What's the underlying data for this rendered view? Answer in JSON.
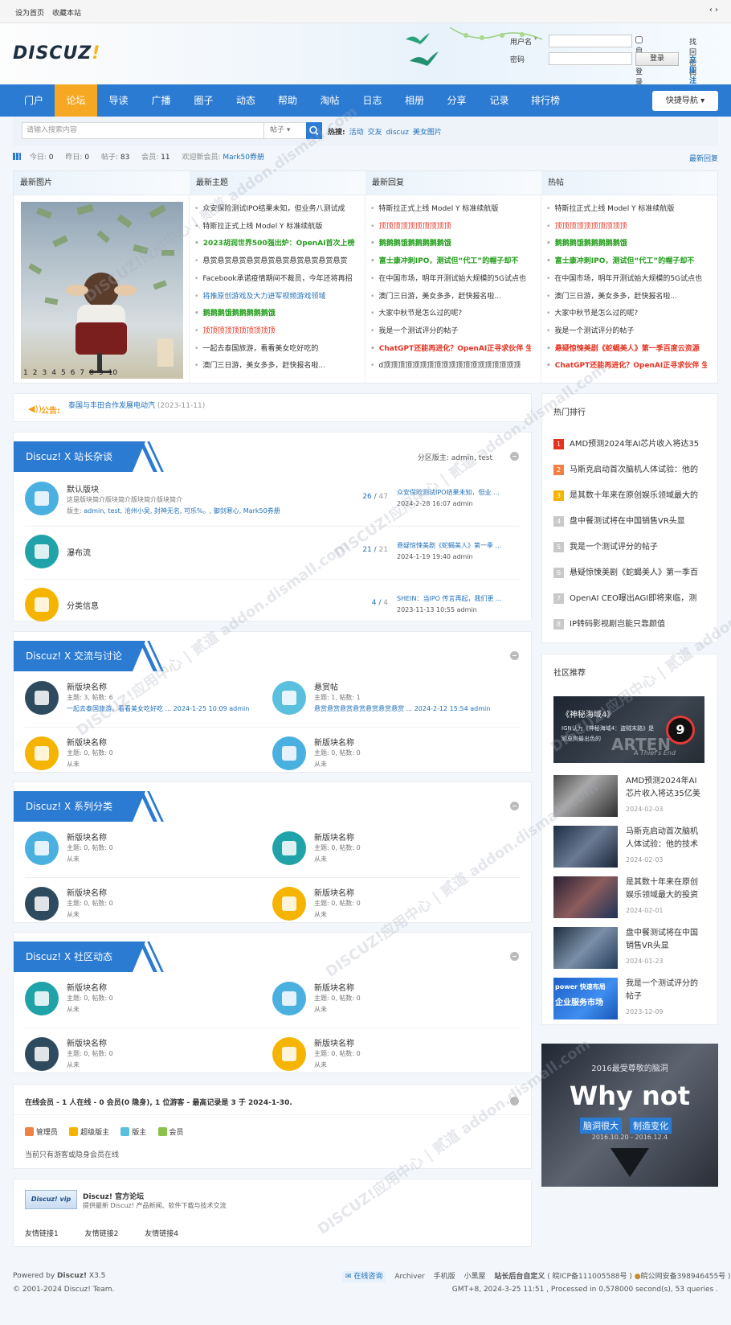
{
  "topbar": {
    "home": "设为首页",
    "fav": "收藏本站",
    "switch": "‹ ›"
  },
  "logo": {
    "main": "DISCUZ",
    "bang": "!"
  },
  "login": {
    "user_label": "用户名",
    "pass_label": "密码",
    "auto": "自动登录",
    "forgot": "找回密码",
    "submit": "登录",
    "register": "立即注册"
  },
  "nav": {
    "items": [
      "门户",
      "论坛",
      "导读",
      "广播",
      "圈子",
      "动态",
      "帮助",
      "淘帖",
      "日志",
      "相册",
      "分享",
      "记录",
      "排行榜"
    ],
    "active": 1,
    "quick": "快捷导航"
  },
  "search": {
    "placeholder": "请输入搜索内容",
    "type": "帖子",
    "hot_label": "热搜:",
    "hot": [
      "活动",
      "交友",
      "discuz",
      "美女图片"
    ]
  },
  "stats": {
    "today_label": "今日:",
    "today": "0",
    "yesterday_label": "昨日:",
    "yesterday": "0",
    "posts_label": "帖子:",
    "posts": "83",
    "members_label": "会员:",
    "members": "11",
    "welcome": "欢迎新会员:",
    "newuser": "Mark50券册",
    "latest_reply": "最新回复"
  },
  "portal": {
    "heads": [
      "最新图片",
      "最新主题",
      "最新回复",
      "热帖"
    ],
    "pager": [
      "1",
      "2",
      "3",
      "4",
      "5",
      "6",
      "7",
      "8",
      "9",
      "10"
    ],
    "topics": [
      {
        "t": "众安保险测试IPO结果未知，但业务八测试成",
        "c": ""
      },
      {
        "t": "特斯拉正式上线 Model Y 标准续航版",
        "c": ""
      },
      {
        "t": "2023胡润世界500强出炉：OpenAI首次上榜",
        "c": "grn"
      },
      {
        "t": "悬赏悬赏悬赏悬赏悬赏悬赏悬赏悬赏悬赏悬赏",
        "c": ""
      },
      {
        "t": "Facebook承诺疫情期间不裁员，今年还将再招",
        "c": ""
      },
      {
        "t": "将推原创游戏及大力进军视频游戏领域",
        "c": "blu"
      },
      {
        "t": "鹅鹅鹅饿鹅鹅鹅鹅鹅饿",
        "c": "grn"
      },
      {
        "t": "顶顶顶顶顶顶顶顶顶顶",
        "c": "red"
      },
      {
        "t": "一起去泰国旅游，看看美女吃好吃的",
        "c": ""
      },
      {
        "t": "澳门三日游，美女多多，赶快报名啦...",
        "c": ""
      }
    ],
    "replies": [
      {
        "t": "特斯拉正式上线 Model Y 标准续航版",
        "c": ""
      },
      {
        "t": "顶顶顶顶顶顶顶顶顶顶",
        "c": "red"
      },
      {
        "t": "鹅鹅鹅饿鹅鹅鹅鹅鹅饿",
        "c": "grn"
      },
      {
        "t": "富士康冲刺IPO，测试但“代工”的帽子却不",
        "c": "grn"
      },
      {
        "t": "在中国市场，明年开测试始大规模的5G试点也",
        "c": ""
      },
      {
        "t": "澳门三日游，美女多多，赶快报名啦...",
        "c": ""
      },
      {
        "t": "大家中秋节是怎么过的呢?",
        "c": ""
      },
      {
        "t": "我是一个测试评分的帖子",
        "c": ""
      },
      {
        "t": "ChatGPT还能再进化？OpenAI正寻求伙伴 生",
        "c": "bred"
      },
      {
        "t": "d顶顶顶顶顶顶顶顶顶顶顶顶顶顶顶顶顶顶顶",
        "c": ""
      }
    ],
    "hot": [
      {
        "t": "特斯拉正式上线 Model Y 标准续航版",
        "c": ""
      },
      {
        "t": "顶顶顶顶顶顶顶顶顶顶",
        "c": "red"
      },
      {
        "t": "鹅鹅鹅饿鹅鹅鹅鹅鹅饿",
        "c": "grn"
      },
      {
        "t": "富士康冲刺IPO，测试但“代工”的帽子却不",
        "c": "grn"
      },
      {
        "t": "在中国市场，明年开测试始大规模的5G试点也",
        "c": ""
      },
      {
        "t": "澳门三日游，美女多多，赶快报名啦...",
        "c": ""
      },
      {
        "t": "大家中秋节是怎么过的呢?",
        "c": ""
      },
      {
        "t": "我是一个测试评分的帖子",
        "c": ""
      },
      {
        "t": "悬疑惊悚美剧《蛇蝎美人》第一季百度云资源",
        "c": "bred"
      },
      {
        "t": "ChatGPT还能再进化？OpenAI正寻求伙伴 生",
        "c": "bred"
      }
    ]
  },
  "notice": {
    "label": "公告:",
    "text": "泰国与丰田合作发展电动汽",
    "date": "(2023-11-11)"
  },
  "sections": [
    {
      "title": "Discuz! X 站长杂谈",
      "mods": "分区版主: admin, test"
    },
    {
      "title": "Discuz! X 交流与讨论",
      "mods": ""
    },
    {
      "title": "Discuz! X 系列分类",
      "mods": ""
    },
    {
      "title": "Discuz! X 社区动态",
      "mods": ""
    }
  ],
  "sec1": [
    {
      "name": "默认版块",
      "desc": "这是版块简介版块简介版块简介版块简介",
      "mods_label": "版主:",
      "mods": "admin, test, 沧州小吴, 封神无名, 可乐%。, 御剑寒心, Mark50券册",
      "cnt": "26",
      "total": "47",
      "last": "众安保险测试IPO结果未知，但业 ...",
      "time": "2024-2-28 16:07 admin",
      "icon": "globe-icon",
      "bg": "#4ab0e0"
    },
    {
      "name": "瀑布流",
      "desc": "",
      "mods_label": "",
      "mods": "",
      "cnt": "21",
      "total": "21",
      "last": "悬疑惊悚美剧《蛇蝎美人》第一季 ...",
      "time": "2024-1-19 19:40 admin",
      "icon": "rocket-icon",
      "bg": "#1fa3a8"
    },
    {
      "name": "分类信息",
      "desc": "",
      "mods_label": "",
      "mods": "",
      "cnt": "4",
      "total": "4",
      "last": "SHEIN：当IPO 传言再起，我们更 ...",
      "time": "2023-11-13 10:55 admin",
      "icon": "chat-icon",
      "bg": "#f5b400"
    }
  ],
  "sec2": [
    {
      "name": "新版块名称",
      "m1": "主题: 3, 帖数: 6",
      "m2": "一起去泰国旅游，看看美女吃好吃 ... 2024-1-25 10:09 admin",
      "icon": "cloud-icon",
      "bg": "#2e4a5e"
    },
    {
      "name": "悬赏帖",
      "m1": "主题: 1, 帖数: 1",
      "m2": "悬赏悬赏悬赏悬赏悬赏悬赏悬赏 ... 2024-2-12 15:54 admin",
      "icon": "search-doc-icon",
      "bg": "#5bc0de"
    },
    {
      "name": "新版块名称",
      "m1": "主题: 0, 帖数: 0",
      "m2": "从未",
      "icon": "calendar-icon",
      "bg": "#f5b400"
    },
    {
      "name": "新版块名称",
      "m1": "主题: 0, 帖数: 0",
      "m2": "从未",
      "icon": "photo-icon",
      "bg": "#4ab0e0"
    }
  ],
  "sec3": [
    {
      "name": "新版块名称",
      "m1": "主题: 0, 帖数: 0",
      "m2": "从未",
      "icon": "screen-icon",
      "bg": "#4ab0e0"
    },
    {
      "name": "新版块名称",
      "m1": "主题: 0, 帖数: 0",
      "m2": "从未",
      "icon": "document-icon",
      "bg": "#1fa3a8"
    },
    {
      "name": "新版块名称",
      "m1": "主题: 0, 帖数: 0",
      "m2": "从未",
      "icon": "bag-icon",
      "bg": "#2e4a5e"
    },
    {
      "name": "新版块名称",
      "m1": "主题: 0, 帖数: 0",
      "m2": "从未",
      "icon": "microscope-icon",
      "bg": "#f5b400"
    }
  ],
  "sec4": [
    {
      "name": "新版块名称",
      "m1": "主题: 0, 帖数: 0",
      "m2": "从未",
      "icon": "pen-icon",
      "bg": "#1fa3a8"
    },
    {
      "name": "新版块名称",
      "m1": "主题: 0, 帖数: 0",
      "m2": "从未",
      "icon": "briefcase-icon",
      "bg": "#4ab0e0"
    },
    {
      "name": "新版块名称",
      "m1": "主题: 0, 帖数: 0",
      "m2": "从未",
      "icon": "trophy-icon",
      "bg": "#2e4a5e"
    },
    {
      "name": "新版块名称",
      "m1": "主题: 0, 帖数: 0",
      "m2": "从未",
      "icon": "mail-icon",
      "bg": "#f5b400"
    }
  ],
  "online": {
    "title": "在线会员 - 1 人在线 - 0 会员(0 隐身), 1 位游客 - 最高记录是 3 于 2024-1-30.",
    "legend": [
      "管理员",
      "超级版主",
      "版主",
      "会员"
    ],
    "note": "当前只有游客或隐身会员在线"
  },
  "friends": {
    "name": "Discuz! 官方论坛",
    "desc": "提供最新 Discuz! 产品新闻、软件下载与技术交流",
    "logo": "Discuz! vip",
    "links": [
      "友情链接1",
      "友情链接2",
      "友情链接4"
    ]
  },
  "side_rank": {
    "title": "热门排行",
    "items": [
      "AMD预测2024年AI芯片收入将达35",
      "马斯克启动首次脑机人体试验：他的",
      "是其数十年来在原创娱乐领域最大的",
      "盘中餐测试将在中国销售VR头显",
      "我是一个测试评分的帖子",
      "悬疑惊悚美剧《蛇蝎美人》第一季百",
      "OpenAI CEO曝出AGI即将来临，测",
      "IP转码影视剧岂能只靠颜值"
    ]
  },
  "side_rec": {
    "title": "社区推荐",
    "banner_title": "《神秘海域4》",
    "banner_sub": "IGN认为《神秘海域4：盗贼末路》是顽皮狗最出色的",
    "banner_score": "9",
    "banner_word": "ARTEN",
    "banner_tag": "A Thief's End",
    "items": [
      {
        "t": "AMD预测2024年AI芯片收入将达35亿美",
        "d": "2024-02-03"
      },
      {
        "t": "马斯克启动首次脑机人体试验：他的技术",
        "d": "2024-02-03"
      },
      {
        "t": "是其数十年来在原创娱乐领域最大的投资",
        "d": "2024-02-01"
      },
      {
        "t": "盘中餐测试将在中国销售VR头显",
        "d": "2024-01-23"
      },
      {
        "t": "我是一个测试评分的帖子",
        "d": "2023-12-09"
      }
    ],
    "last_thumb_a": "power 快速布局",
    "last_thumb_b": "企业服务市场"
  },
  "ad": {
    "top": "2016最受尊敬的脑洞",
    "big": "Why not",
    "a": "脑洞很大",
    "b": "制造变化",
    "date": "2016.10.20 - 2016.12.4"
  },
  "footer": {
    "powered": "Powered by",
    "brand": "Discuz!",
    "ver": "X3.5",
    "copy": "© 2001-2024 Discuz! Team.",
    "consult": "在线咨询",
    "links": [
      "Archiver",
      "手机版",
      "小黑屋"
    ],
    "custom": "站长后台自定义",
    "icp": "( 皖ICP备111005588号 )",
    "police": "皖公网安备398946455号 )",
    "gmt": "GMT+8, 2024-3-25 11:51 , Processed in 0.578000 second(s), 53 queries ."
  },
  "watermark": "DISCUZ!应用中心 | 贰道 addon.dismall.com"
}
